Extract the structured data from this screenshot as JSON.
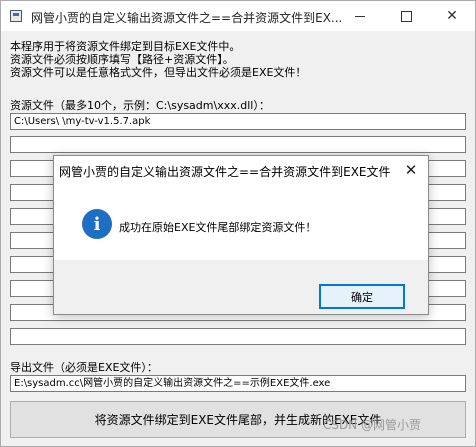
{
  "window": {
    "title": "网管小贾的自定义输出资源文件之==合并资源文件到EX...",
    "min_glyph": "",
    "close_glyph": "✕"
  },
  "info_lines": [
    "本程序用于将资源文件绑定到目标EXE文件中。",
    "资源文件必须按顺序填写【路径+资源文件】。",
    "资源文件可以是任意格式文件，但导出文件必须是EXE文件！"
  ],
  "resources": {
    "label": "资源文件（最多10个，示例：C:\\sysadm\\xxx.dll）：",
    "fields": [
      "C:\\Users\\                                        \\my-tv-v1.5.7.apk",
      "",
      "",
      "",
      "",
      "",
      "",
      "",
      "",
      ""
    ]
  },
  "export": {
    "label": "导出文件（必须是EXE文件）：",
    "value": "E:\\sysadm.cc\\网管小贾的自定义输出资源文件之==示例EXE文件.exe"
  },
  "main_button": {
    "label": "将资源文件绑定到EXE文件尾部，并生成新的EXE文件"
  },
  "watermark": "CSDN @网管小贾",
  "dialog": {
    "title": "网管小贾的自定义输出资源文件之==合并资源文件到EXE文件",
    "close_glyph": "✕",
    "icon_glyph": "i",
    "message": "成功在原始EXE文件尾部绑定资源文件！",
    "ok_label": "确定"
  }
}
